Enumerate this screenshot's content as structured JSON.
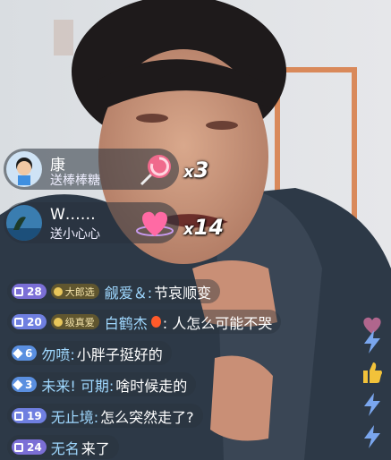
{
  "gifts": [
    {
      "user": "康",
      "action": "送棒棒糖",
      "icon": "lollipop-icon",
      "count_prefix": "x",
      "count": "3"
    },
    {
      "user": "W……",
      "action": "送小心心",
      "icon": "heart-icon",
      "count_prefix": "x",
      "count": "14"
    }
  ],
  "chat": [
    {
      "level": "28",
      "level_color": "#7b6fd6",
      "fan_badge": "大郎选",
      "name": "觎爱＆:",
      "text": "节哀顺变"
    },
    {
      "level": "20",
      "level_color": "#6f7fe0",
      "fan_badge": "级真爱",
      "name": "白鹤杰",
      "text": ": 人怎么可能不哭"
    },
    {
      "level": "6",
      "level_color": "#5a8fe0",
      "fan_badge": "",
      "name": "勿喷:",
      "text": "小胖子挺好的"
    },
    {
      "level": "3",
      "level_color": "#5a8fe0",
      "fan_badge": "",
      "name": "未来! 可期:",
      "text": "啥时候走的"
    },
    {
      "level": "19",
      "level_color": "#6f7fe0",
      "fan_badge": "",
      "name": "无止境:",
      "text": "怎么突然走了?"
    },
    {
      "level": "24",
      "level_color": "#7b6fd6",
      "fan_badge": "",
      "name": "无名",
      "text": "来了"
    }
  ]
}
